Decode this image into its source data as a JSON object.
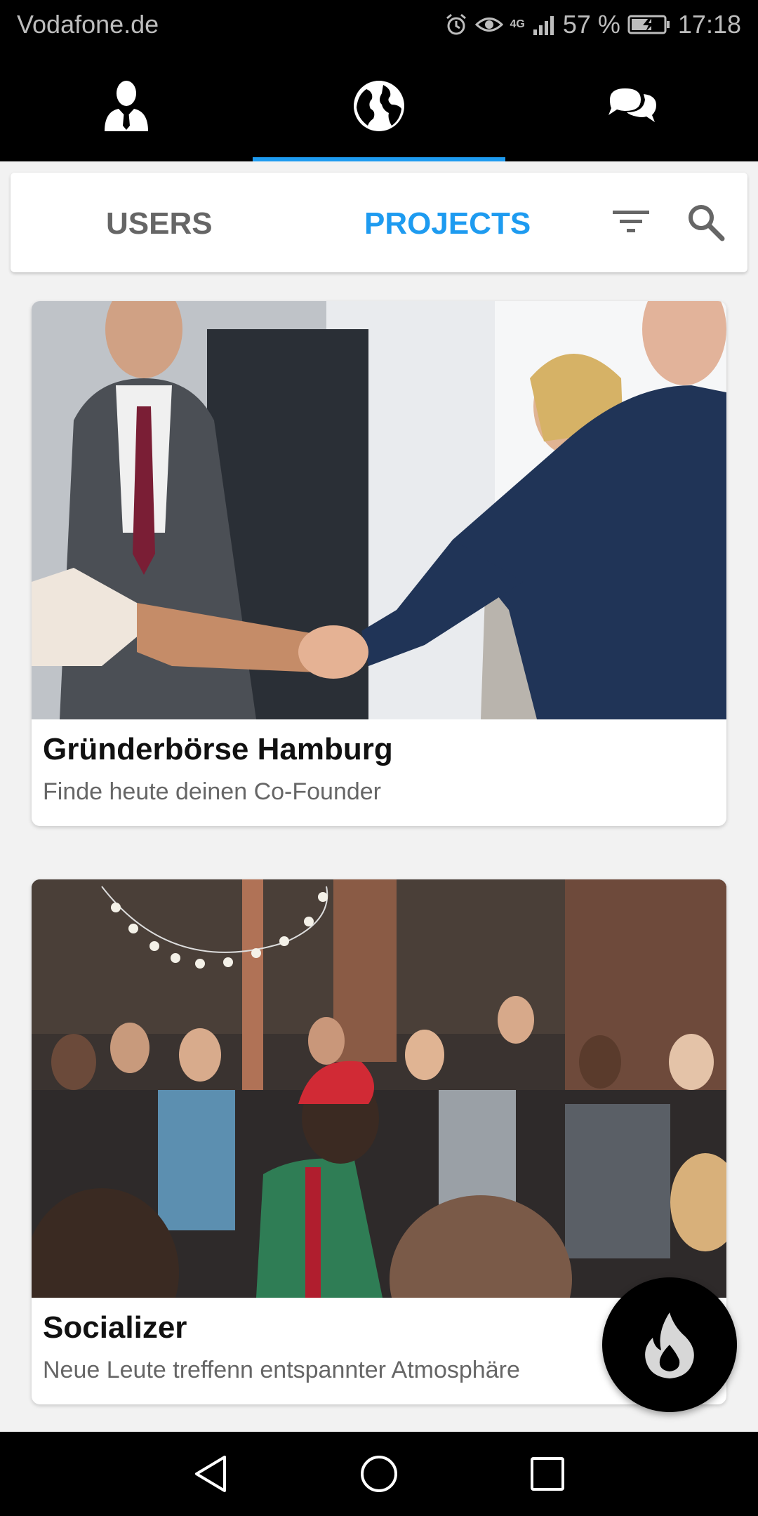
{
  "status_bar": {
    "carrier": "Vodafone.de",
    "network": "4G",
    "battery": "57 %",
    "time": "17:18",
    "icons": [
      "alarm-icon",
      "eye-icon",
      "signal-icon",
      "battery-charging-icon"
    ]
  },
  "top_nav": {
    "tabs": [
      {
        "icon": "user-profile-icon"
      },
      {
        "icon": "globe-icon",
        "selected": true
      },
      {
        "icon": "chat-bubbles-icon"
      }
    ],
    "accent": "#1e9bf0"
  },
  "sub_tabs": {
    "users_label": "USERS",
    "projects_label": "PROJECTS",
    "active": "PROJECTS",
    "icons": [
      "filter-icon",
      "search-icon"
    ]
  },
  "projects": [
    {
      "title": "Gründerbörse Hamburg",
      "subtitle": "Finde heute deinen Co-Founder",
      "image": "handshake-photo"
    },
    {
      "title": "Socializer",
      "subtitle": "Neue Leute treffenn entspannter Atmosphäre",
      "image": "crowd-party-photo"
    }
  ],
  "fab": {
    "icon": "flame-icon"
  },
  "system_nav": {
    "icons": [
      "back-icon",
      "home-icon",
      "recent-apps-icon"
    ]
  }
}
